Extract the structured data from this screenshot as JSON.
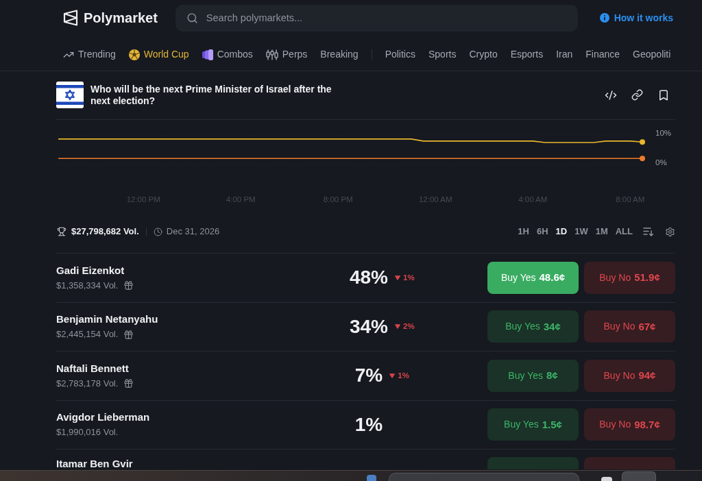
{
  "header": {
    "logo": "Polymarket",
    "search": {
      "placeholder": "Search polymarkets..."
    },
    "help_link": "How it works"
  },
  "nav": {
    "primary": [
      {
        "label": "Trending",
        "featured": false
      },
      {
        "label": "World Cup",
        "featured": true
      },
      {
        "label": "Combos",
        "featured": false
      },
      {
        "label": "Perps",
        "featured": false
      },
      {
        "label": "Breaking",
        "featured": false
      }
    ],
    "categories": [
      "Politics",
      "Sports",
      "Crypto",
      "Esports",
      "Iran",
      "Finance",
      "Geopoliti"
    ]
  },
  "market": {
    "title": "Who will be the next Prime Minister of Israel after the next election?",
    "chart_data": {
      "type": "line",
      "categories": [
        null,
        null,
        null,
        null,
        null,
        null,
        null,
        "12:00 PM",
        null,
        null,
        null,
        null,
        null,
        null,
        null,
        "4:00 PM",
        null,
        null,
        null,
        null,
        null,
        null,
        null,
        "8:00 PM",
        null,
        null,
        null,
        null,
        null,
        null,
        null,
        "12:00 AM",
        null,
        null,
        null,
        null,
        null,
        null,
        null,
        "4:00 AM",
        null,
        null,
        null,
        null,
        null,
        null,
        null,
        "8:00 AM",
        null
      ],
      "series": [
        {
          "color": "#e9b62e",
          "values": [
            8.4,
            8.4,
            8.4,
            8.4,
            8.4,
            8.4,
            8.4,
            8.4,
            8.4,
            8.4,
            8.4,
            8.4,
            8.4,
            8.4,
            8.4,
            8.4,
            8.4,
            8.4,
            8.4,
            8.4,
            8.4,
            8.4,
            8.4,
            8.4,
            8.4,
            8.4,
            8.4,
            8.4,
            8.4,
            8.4,
            7.7,
            7.7,
            7.7,
            7.7,
            7.7,
            7.7,
            7.7,
            7.7,
            7.7,
            7.7,
            7.2,
            7.2,
            7.2,
            7.2,
            7.2,
            7.7,
            7.7,
            7.7,
            7.4
          ]
        },
        {
          "color": "#f07a2c",
          "values": [
            1.8,
            1.8,
            1.8,
            1.8,
            1.8,
            1.8,
            1.8,
            1.8,
            1.8,
            1.8,
            1.8,
            1.8,
            1.8,
            1.8,
            1.8,
            1.8,
            1.8,
            1.8,
            1.8,
            1.8,
            1.8,
            1.8,
            1.8,
            1.8,
            1.8,
            1.8,
            1.8,
            1.8,
            1.8,
            1.8,
            1.8,
            1.8,
            1.8,
            1.8,
            1.8,
            1.8,
            1.8,
            1.8,
            1.8,
            1.8,
            1.8,
            1.8,
            1.8,
            1.8,
            1.8,
            1.8,
            1.8,
            1.8,
            1.8
          ]
        }
      ],
      "ylim": [
        0,
        10
      ],
      "yticks": [
        {
          "value": 10,
          "label": "10%"
        },
        {
          "value": 0,
          "label": "0%"
        }
      ]
    },
    "volume": "$27,798,682 Vol.",
    "end_date": "Dec 31, 2026",
    "timeframes": [
      {
        "label": "1H",
        "selected": false
      },
      {
        "label": "6H",
        "selected": false
      },
      {
        "label": "1D",
        "selected": true
      },
      {
        "label": "1W",
        "selected": false
      },
      {
        "label": "1M",
        "selected": false
      },
      {
        "label": "ALL",
        "selected": false
      }
    ]
  },
  "outcomes": [
    {
      "kind": "full",
      "name": "Gadi Eizenkot",
      "volume": "$1,358,334 Vol.",
      "reward": true,
      "chance": "48%",
      "change": {
        "value": "1%",
        "down": true
      },
      "yes": {
        "label": "Buy Yes",
        "price": "48.6¢",
        "highlighted": true
      },
      "no": {
        "label": "Buy No",
        "price": "51.9¢"
      }
    },
    {
      "kind": "full",
      "name": "Benjamin Netanyahu",
      "volume": "$2,445,154 Vol.",
      "reward": true,
      "chance": "34%",
      "change": {
        "value": "2%",
        "down": true
      },
      "yes": {
        "label": "Buy Yes",
        "price": "34¢",
        "highlighted": false
      },
      "no": {
        "label": "Buy No",
        "price": "67¢"
      }
    },
    {
      "kind": "full",
      "name": "Naftali Bennett",
      "volume": "$2,783,178 Vol.",
      "reward": true,
      "chance": "7%",
      "change": {
        "value": "1%",
        "down": true
      },
      "yes": {
        "label": "Buy Yes",
        "price": "8¢",
        "highlighted": false
      },
      "no": {
        "label": "Buy No",
        "price": "94¢"
      }
    },
    {
      "kind": "full",
      "name": "Avigdor Lieberman",
      "volume": "$1,990,016 Vol.",
      "reward": false,
      "chance": "1%",
      "yes": {
        "label": "Buy Yes",
        "price": "1.5¢",
        "highlighted": false
      },
      "no": {
        "label": "Buy No",
        "price": "98.7¢"
      }
    },
    {
      "kind": "cut",
      "name": "Itamar Ben Gvir"
    }
  ]
}
